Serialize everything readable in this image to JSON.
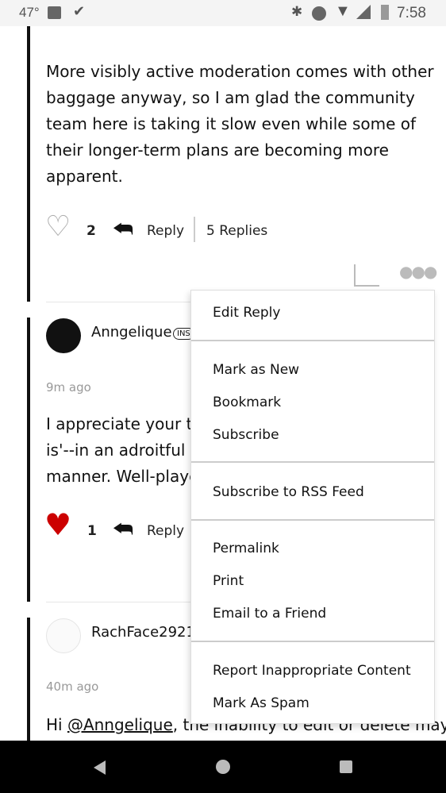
{
  "status_bar": {
    "temperature": "47°",
    "time": "7:58",
    "icons": [
      "image-icon",
      "checklist-icon",
      "bluetooth-icon",
      "do-not-disturb-icon",
      "wifi-icon",
      "signal-icon",
      "battery-charging-icon"
    ]
  },
  "post1": {
    "body_lines": [
      "More visibly active moderation comes with other",
      "baggage anyway, so I am glad the community",
      "team here is taking it slow even while some of",
      "their longer-term plans are becoming more",
      "apparent."
    ],
    "likes": "2",
    "reply_label": "Reply",
    "replies_label": "5 Replies"
  },
  "post2": {
    "author": "Anngelique",
    "badge": "INS",
    "time": "9m ago",
    "body_lines": [
      "I appreciate your t",
      "is'--in an adroitful",
      "manner. Well-playe"
    ],
    "likes": "1",
    "reply_label": "Reply",
    "like_color": "#cc0000"
  },
  "post3": {
    "author": "RachFace2921",
    "time": "40m ago",
    "body_prefix": "Hi ",
    "mention": "@Anngelique",
    "body_suffix": ", the inability to edit or delete may"
  },
  "menu": {
    "items": [
      "Edit Reply",
      "Mark as New",
      "Bookmark",
      "Subscribe",
      "Subscribe to RSS Feed",
      "Permalink",
      "Print",
      "Email to a Friend",
      "Report Inappropriate Content",
      "Mark As Spam"
    ]
  }
}
